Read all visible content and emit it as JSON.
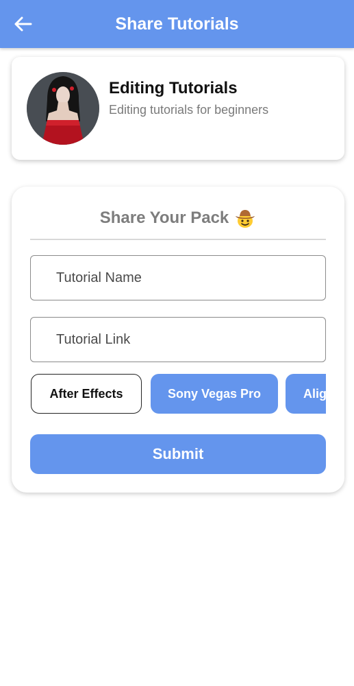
{
  "app_bar": {
    "title": "Share Tutorials",
    "back_icon": "arrow-left-icon",
    "color": "#6495ED"
  },
  "profile": {
    "name": "Editing Tutorials",
    "description": "Editing tutorials for beginners"
  },
  "form": {
    "title": "Share Your Pack",
    "title_emoji": "cowboy-hat-face-icon",
    "tutorial_name_placeholder": "Tutorial Name",
    "tutorial_link_placeholder": "Tutorial Link",
    "chips": [
      {
        "label": "After Effects",
        "selected": false
      },
      {
        "label": "Sony Vegas Pro",
        "selected": true
      },
      {
        "label": "Alig",
        "selected": true
      }
    ],
    "submit_label": "Submit"
  }
}
